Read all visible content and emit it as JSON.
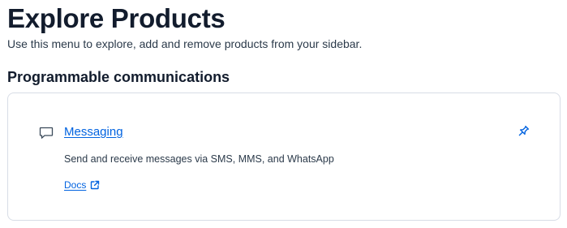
{
  "header": {
    "title": "Explore Products",
    "subtitle": "Use this menu to explore, add and remove products from your sidebar."
  },
  "section": {
    "heading": "Programmable communications"
  },
  "product_card": {
    "icon": "chat-bubble-icon",
    "name": "Messaging",
    "description": "Send and receive messages via SMS, MMS, and WhatsApp",
    "docs_label": "Docs",
    "docs_icon": "external-link-icon",
    "pin_icon": "pin-icon"
  },
  "colors": {
    "link": "#0263e0",
    "heading": "#121c2d",
    "body_text": "#2b3a4a",
    "card_border": "#d8dde6"
  }
}
